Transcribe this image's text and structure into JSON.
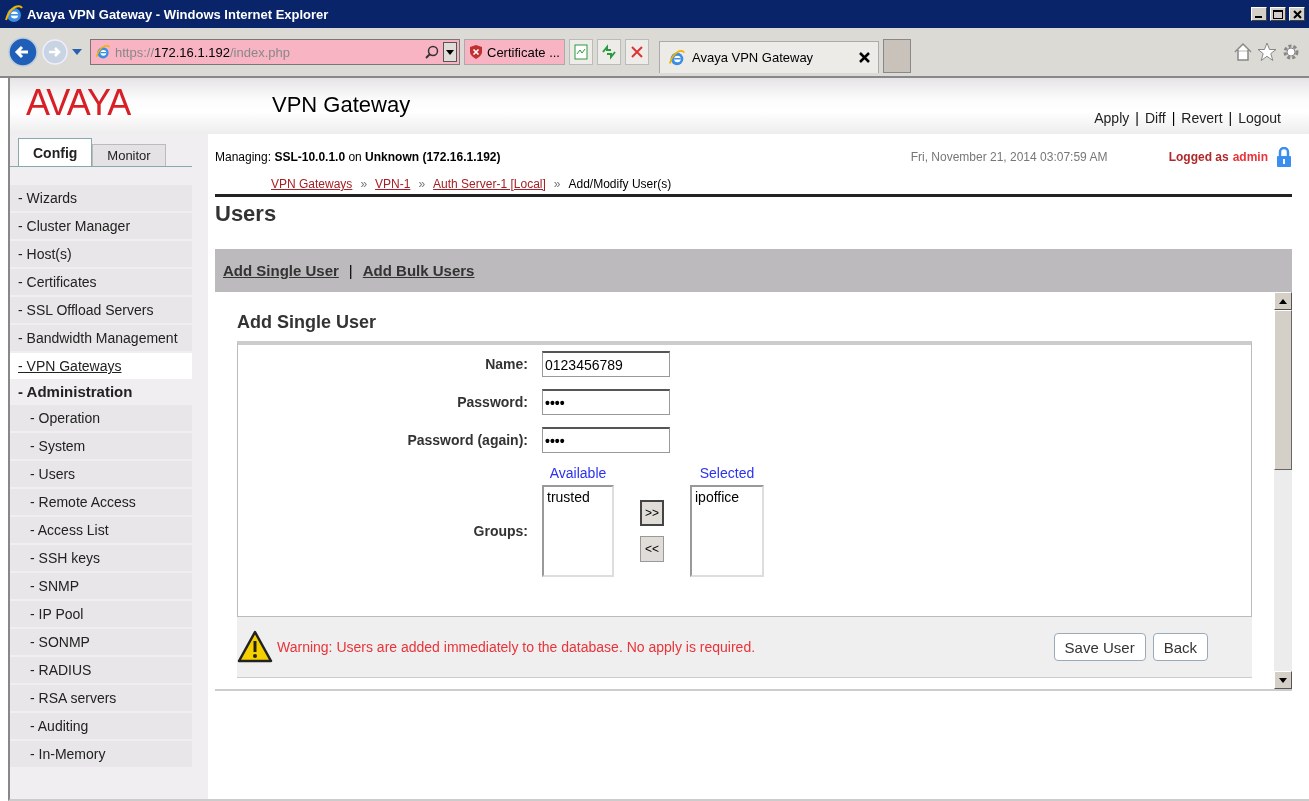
{
  "window": {
    "title": "Avaya VPN Gateway - Windows Internet Explorer"
  },
  "browser": {
    "address": {
      "scheme": "https://",
      "host": "172.16.1.192",
      "path": "/index.php"
    },
    "certificate": "Certificate ...",
    "tabs": [
      {
        "label": "Avaya VPN Gateway",
        "selected": true
      }
    ]
  },
  "header": {
    "logo": "AVAYA",
    "product": "VPN Gateway",
    "actions": [
      {
        "kind": "link",
        "text": "Apply"
      },
      {
        "kind": "sep",
        "text": "|"
      },
      {
        "kind": "link",
        "text": "Diff"
      },
      {
        "kind": "sep",
        "text": "|"
      },
      {
        "kind": "link",
        "text": "Revert"
      },
      {
        "kind": "sep",
        "text": "|"
      },
      {
        "kind": "link",
        "text": "Logout"
      }
    ]
  },
  "sidebar": {
    "tabs": [
      {
        "label": "Config",
        "selected": true
      },
      {
        "label": "Monitor",
        "selected": false
      }
    ],
    "items": [
      {
        "label": "- Wizards",
        "selected": false
      },
      {
        "label": "- Cluster Manager",
        "selected": false
      },
      {
        "label": "- Host(s)",
        "selected": false
      },
      {
        "label": "- Certificates",
        "selected": false
      },
      {
        "label": "- SSL Offload Servers",
        "selected": false
      },
      {
        "label": "- Bandwidth Management",
        "selected": false
      },
      {
        "label": "- VPN Gateways",
        "selected": true
      },
      {
        "label": "- Administration",
        "selected": false,
        "expanded": true,
        "children": [
          {
            "label": "- Operation",
            "selected": false
          },
          {
            "label": "- System",
            "selected": false
          },
          {
            "label": "- Users",
            "selected": false
          },
          {
            "label": "- Remote Access",
            "selected": false
          },
          {
            "label": "- Access List",
            "selected": false
          },
          {
            "label": "- SSH keys",
            "selected": false
          },
          {
            "label": "- SNMP",
            "selected": false
          },
          {
            "label": "- IP Pool",
            "selected": false
          },
          {
            "label": "- SONMP",
            "selected": false
          },
          {
            "label": "- RADIUS",
            "selected": false
          },
          {
            "label": "- RSA servers",
            "selected": false
          },
          {
            "label": "- Auditing",
            "selected": false
          },
          {
            "label": "- In-Memory",
            "selected": false
          }
        ]
      }
    ]
  },
  "status": {
    "managing": "Managing:  **SSL-10.0.1.0** on  **Unknown (172.16.1.192)**",
    "datetime": "Fri, November 21, 2014 03:07:59 AM",
    "logged_as": "Logged as",
    "user": "admin"
  },
  "breadcrumb": [
    {
      "kind": "link",
      "text": "VPN Gateways"
    },
    {
      "kind": "sep",
      "text": "»"
    },
    {
      "kind": "link",
      "text": "VPN-1"
    },
    {
      "kind": "sep",
      "text": "»"
    },
    {
      "kind": "link",
      "text": "Auth Server-1 [Local]"
    },
    {
      "kind": "sep",
      "text": "»"
    },
    {
      "kind": "current",
      "text": "Add/Modify User(s)"
    }
  ],
  "page_title": "Users",
  "subnav": [
    {
      "kind": "link",
      "text": "Add Single User"
    },
    {
      "kind": "sep",
      "text": "|"
    },
    {
      "kind": "link",
      "text": "Add Bulk Users"
    }
  ],
  "form": {
    "title": "Add Single User",
    "fields": [
      {
        "label": "Name:",
        "value": "0123456789",
        "kind": "text"
      },
      {
        "label": "Password:",
        "value": "••••",
        "kind": "password"
      },
      {
        "label": "Password (again):",
        "value": "••••",
        "kind": "password"
      }
    ],
    "groups": {
      "label": "Groups:",
      "available_title": "Available",
      "selected_title": "Selected",
      "available": [
        "trusted"
      ],
      "selected": [
        "ipoffice"
      ],
      "add": ">>",
      "remove": "<<"
    },
    "warning": "Warning: Users are added immediately to the database. No apply is required.",
    "buttons": [
      "Save User",
      "Back"
    ]
  }
}
